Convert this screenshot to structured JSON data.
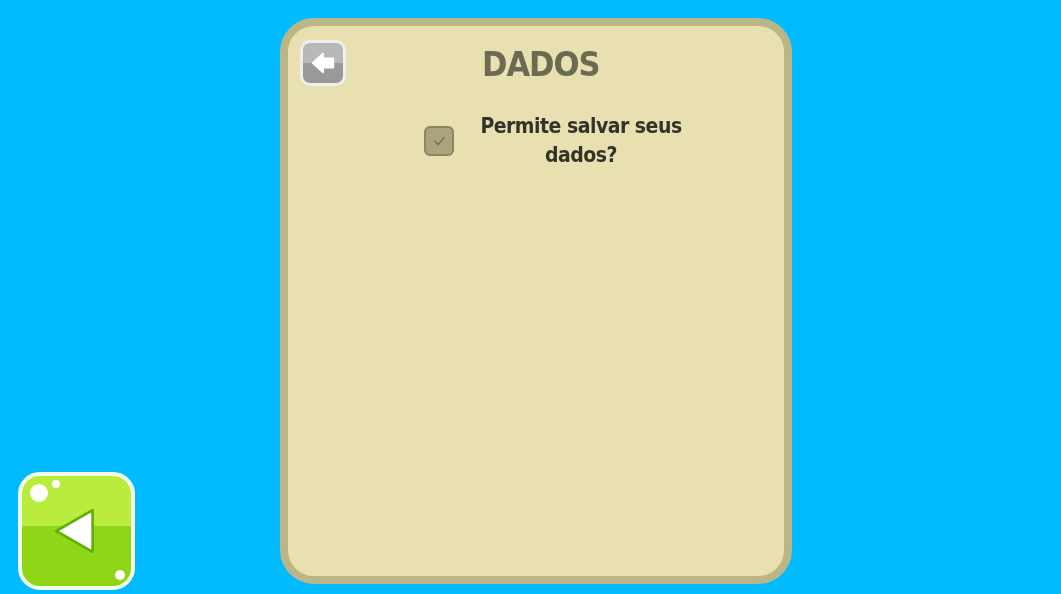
{
  "panel": {
    "title": "DADOS"
  },
  "options": [
    {
      "label": "Permite salvar seus dados?",
      "checked": true
    }
  ]
}
